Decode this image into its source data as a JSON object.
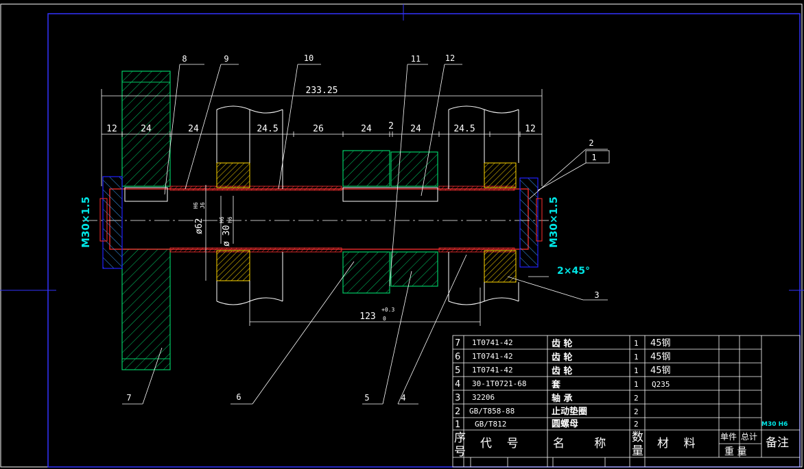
{
  "dimensions": {
    "overall": "233.25",
    "d12_left": "12",
    "d24_a": "24",
    "d24_b": "24",
    "d245_a": "24.5",
    "d26": "26",
    "d24_c": "24",
    "d2": "2",
    "d24_d": "24",
    "d245_b": "24.5",
    "d12_right": "12",
    "span123": "123",
    "tol_upper": "+0.3",
    "tol_lower": "0",
    "dia62": "ø62",
    "dia62_fit_top": "H6",
    "dia62_fit_bottom": "J6",
    "dia30": "ø 30",
    "dia30_fit_top": "H6",
    "dia30_fit_bottom": "h6",
    "thread_left": "M30×1.5",
    "thread_right": "M30×1.5",
    "chamfer": "2×45°"
  },
  "balloons": [
    "1",
    "2",
    "3",
    "4",
    "5",
    "6",
    "7",
    "8",
    "9",
    "10",
    "11",
    "12"
  ],
  "bom": {
    "rows": [
      {
        "no": "7",
        "code": "1T0741-42",
        "name": "齿  轮",
        "qty": "1",
        "material": "45钢"
      },
      {
        "no": "6",
        "code": "1T0741-42",
        "name": "齿  轮",
        "qty": "1",
        "material": "45钢"
      },
      {
        "no": "5",
        "code": "1T0741-42",
        "name": "齿  轮",
        "qty": "1",
        "material": "45钢"
      },
      {
        "no": "4",
        "code": "30-1T0721-68",
        "name": "套",
        "qty": "1",
        "material": "Q235"
      },
      {
        "no": "3",
        "code": "32206",
        "name": "轴  承",
        "qty": "2",
        "material": ""
      },
      {
        "no": "2",
        "code": "GB/T858-88",
        "name": "止动垫圈",
        "qty": "2",
        "material": ""
      },
      {
        "no": "1",
        "code": "GB/T812",
        "name": "圆螺母",
        "qty": "2",
        "material": ""
      }
    ],
    "header": {
      "no_line1": "序",
      "no_line2": "号",
      "code": "代    号",
      "name": "名        称",
      "qty_line1": "数",
      "qty_line2": "量",
      "material": "材    料",
      "unit": "单件",
      "total": "总计",
      "weight": "重 量",
      "remark": "备注"
    },
    "side_note": "M30 H6"
  },
  "colors": {
    "background": "#000000",
    "outline": "#ffffff",
    "gear_hatch": "#00ff66",
    "blue_hatch": "#3aa0ff",
    "yellow_hatch": "#ffd700",
    "shaft_red": "#ff3030",
    "nut_blue": "#2020ff",
    "dimension_cyan": "#00e5e5"
  }
}
